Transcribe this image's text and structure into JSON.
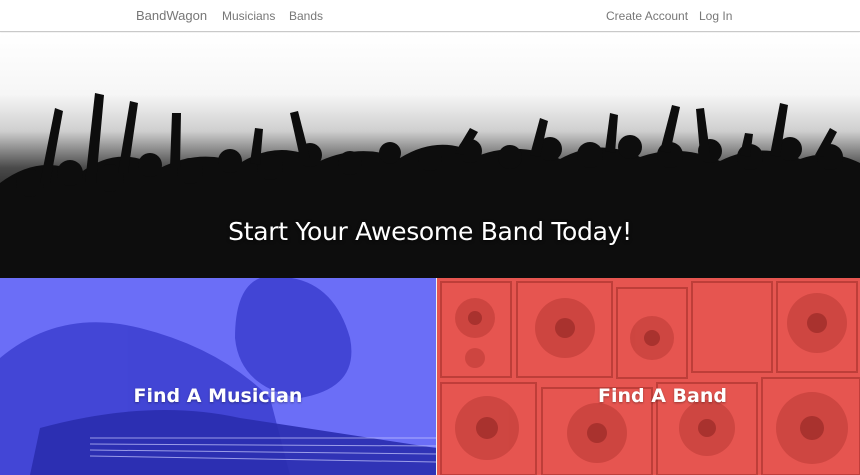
{
  "nav": {
    "brand": "BandWagon",
    "links": [
      "Musicians",
      "Bands"
    ],
    "create_account": "Create Account",
    "login": "Log In"
  },
  "hero": {
    "headline": "Start Your Awesome Band Today!"
  },
  "panels": {
    "musician_label": "Find A Musician",
    "band_label": "Find A Band"
  },
  "colors": {
    "musician_tint": "#6b6ef7",
    "band_tint": "#e65550",
    "nav_text": "#777777"
  }
}
